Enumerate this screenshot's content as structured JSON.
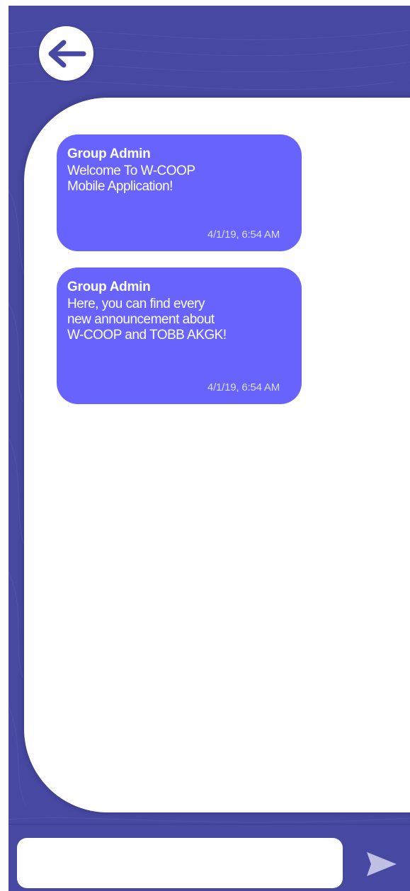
{
  "colors": {
    "background": "#4648a1",
    "bubble": "#6763fc",
    "panel": "#ffffff",
    "timestamp": "#dcdcf8",
    "send_icon": "#bfc0e3"
  },
  "header": {
    "back_icon": "arrow-left-icon"
  },
  "messages": [
    {
      "sender": "Group Admin",
      "text": "Welcome To W-COOP\nMobile Application!",
      "time": "4/1/19, 6:54 AM"
    },
    {
      "sender": "Group Admin",
      "text": "Here, you can find every\nnew announcement about\nW-COOP and TOBB AKGK!",
      "time": "4/1/19, 6:54 AM"
    }
  ],
  "composer": {
    "value": "",
    "placeholder": "",
    "send_icon": "send-icon"
  }
}
